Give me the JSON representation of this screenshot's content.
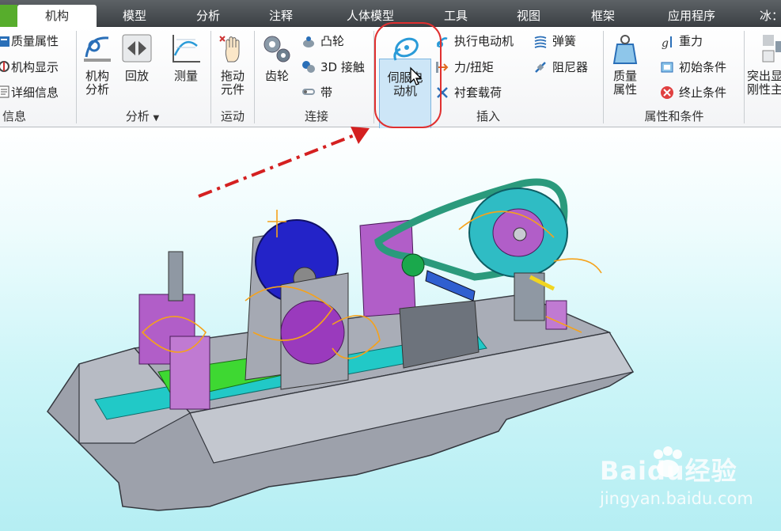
{
  "tabs": [
    {
      "label": "机构",
      "active": true
    },
    {
      "label": "模型"
    },
    {
      "label": "分析"
    },
    {
      "label": "注释"
    },
    {
      "label": "人体模型"
    },
    {
      "label": "工具"
    },
    {
      "label": "视图"
    },
    {
      "label": "框架"
    },
    {
      "label": "应用程序"
    },
    {
      "label": "冰："
    }
  ],
  "ribbon": {
    "info_group": {
      "items": [
        "质量属性",
        "机构显示",
        "详细信息"
      ],
      "label": "信息"
    },
    "analysis_group": {
      "buttons": [
        {
          "line1": "机构",
          "line2": "分析"
        },
        {
          "line1": "回放"
        },
        {
          "line1": "测量"
        }
      ],
      "label": "分析"
    },
    "motion_group": {
      "buttons": [
        {
          "line1": "拖动",
          "line2": "元件"
        }
      ],
      "label": "运动"
    },
    "connect_group": {
      "buttons": [
        {
          "line1": "齿轮"
        }
      ],
      "items": [
        "凸轮",
        "3D 接触",
        "带"
      ],
      "label": "连接"
    },
    "insert_group": {
      "buttons": [
        {
          "line1": "伺服电",
          "line2": "动机"
        }
      ],
      "items": [
        "执行电动机",
        "力/扭矩",
        "衬套载荷",
        "弹簧",
        "阻尼器"
      ],
      "label": "插入"
    },
    "props_group": {
      "buttons": [
        {
          "line1": "质量",
          "line2": "属性"
        }
      ],
      "items": [
        "重力",
        "初始条件",
        "终止条件"
      ],
      "label": "属性和条件"
    },
    "extra_group": {
      "buttons": [
        {
          "line1": "突出显",
          "line2": "刚性主"
        }
      ]
    }
  },
  "watermark": {
    "brand": "Baidu经验",
    "url": "jingyan.baidu.com"
  },
  "colors": {
    "active_tab_edge": "#57ad2c",
    "highlight": "#e03030",
    "arrow": "#d42020"
  }
}
